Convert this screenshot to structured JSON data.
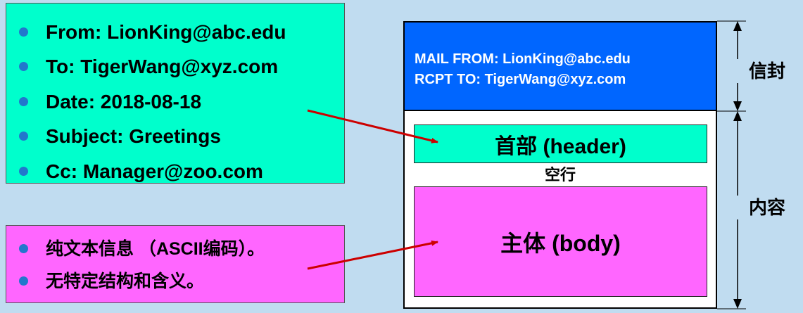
{
  "header_fields": [
    "From: LionKing@abc.edu",
    "To: TigerWang@xyz.com",
    "Date: 2018-08-18",
    "Subject: Greetings",
    "Cc: Manager@zoo.com"
  ],
  "body_notes": [
    "纯文本信息 （ASCII编码）。",
    "无特定结构和含义。"
  ],
  "envelope": {
    "mail_from": "MAIL FROM: LionKing@abc.edu",
    "rcpt_to": "RCPT TO: TigerWang@xyz.com"
  },
  "message": {
    "header_label": "首部 (header)",
    "blank_line_label": "空行",
    "body_label": "主体 (body)"
  },
  "side_labels": {
    "envelope": "信封",
    "content": "内容"
  },
  "colors": {
    "background": "#c0dcf0",
    "header_fill": "#00ffcc",
    "body_fill": "#ff66ff",
    "envelope_fill": "#0066ff",
    "arrow": "#cc0000",
    "bullet": "#2277cc"
  }
}
